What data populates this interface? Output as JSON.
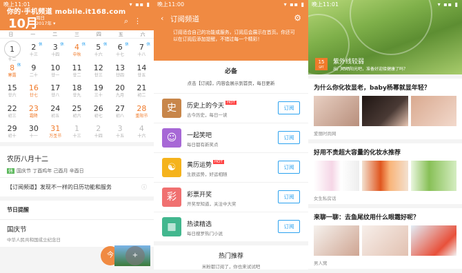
{
  "watermark": "你的·手机频道 mobile.it168.com",
  "status": {
    "time": "晚上11:01",
    "time2": "晚上11:00",
    "time3": "晚上11:01",
    "icons": "▾ ▪▪ ▮"
  },
  "calendar": {
    "month": "10月",
    "month_sub1": "周日",
    "month_sub2": "2017年 ▾",
    "weekdays": [
      "日",
      "一",
      "二",
      "三",
      "四",
      "五",
      "六"
    ],
    "days": [
      {
        "n": "1",
        "l": "十二",
        "t": "",
        "cls": "today"
      },
      {
        "n": "2",
        "l": "十三",
        "t": "休",
        "cls": ""
      },
      {
        "n": "3",
        "l": "十四",
        "t": "休",
        "cls": ""
      },
      {
        "n": "4",
        "l": "中秋",
        "t": "休",
        "cls": "red"
      },
      {
        "n": "5",
        "l": "十六",
        "t": "休",
        "cls": ""
      },
      {
        "n": "6",
        "l": "十七",
        "t": "休",
        "cls": ""
      },
      {
        "n": "7",
        "l": "十八",
        "t": "休",
        "cls": ""
      },
      {
        "n": "8",
        "l": "寒露",
        "t": "休",
        "cls": "red"
      },
      {
        "n": "9",
        "l": "二十",
        "t": "",
        "cls": ""
      },
      {
        "n": "10",
        "l": "廿一",
        "t": "",
        "cls": ""
      },
      {
        "n": "11",
        "l": "廿二",
        "t": "",
        "cls": ""
      },
      {
        "n": "12",
        "l": "廿三",
        "t": "",
        "cls": ""
      },
      {
        "n": "13",
        "l": "廿四",
        "t": "",
        "cls": ""
      },
      {
        "n": "14",
        "l": "廿五",
        "t": "",
        "cls": ""
      },
      {
        "n": "15",
        "l": "廿六",
        "t": "",
        "cls": ""
      },
      {
        "n": "16",
        "l": "廿七",
        "t": "",
        "cls": "red"
      },
      {
        "n": "17",
        "l": "廿八",
        "t": "",
        "cls": ""
      },
      {
        "n": "18",
        "l": "廿九",
        "t": "",
        "cls": ""
      },
      {
        "n": "19",
        "l": "三十",
        "t": "",
        "cls": ""
      },
      {
        "n": "20",
        "l": "九月",
        "t": "",
        "cls": ""
      },
      {
        "n": "21",
        "l": "初二",
        "t": "",
        "cls": ""
      },
      {
        "n": "22",
        "l": "初三",
        "t": "",
        "cls": ""
      },
      {
        "n": "23",
        "l": "霜降",
        "t": "",
        "cls": "red"
      },
      {
        "n": "24",
        "l": "初五",
        "t": "",
        "cls": ""
      },
      {
        "n": "25",
        "l": "初六",
        "t": "",
        "cls": ""
      },
      {
        "n": "26",
        "l": "初七",
        "t": "",
        "cls": ""
      },
      {
        "n": "27",
        "l": "初八",
        "t": "",
        "cls": ""
      },
      {
        "n": "28",
        "l": "重阳节",
        "t": "",
        "cls": "red"
      },
      {
        "n": "29",
        "l": "初十",
        "t": "",
        "cls": ""
      },
      {
        "n": "30",
        "l": "十一",
        "t": "",
        "cls": ""
      },
      {
        "n": "31",
        "l": "万圣节",
        "t": "",
        "cls": "red"
      },
      {
        "n": "1",
        "l": "十三",
        "t": "",
        "cls": "grey"
      },
      {
        "n": "2",
        "l": "十四",
        "t": "",
        "cls": "grey"
      },
      {
        "n": "3",
        "l": "十五",
        "t": "",
        "cls": "grey"
      },
      {
        "n": "4",
        "l": "十六",
        "t": "",
        "cls": "grey"
      }
    ],
    "lunar": "农历八月十二",
    "rest_tag": "休",
    "detail": "国庆节  丁酉鸡年 己酉月 辛酉日",
    "promo": "【订阅频道】发现不一样的日历功能和服务",
    "reminder_title": "节日提醒",
    "holiday": "国庆节",
    "holiday_desc": "中华人民共和国成立纪念日",
    "fab1": "今",
    "fab2": "+"
  },
  "sub": {
    "title": "订阅频道",
    "desc": "订阅适合自己的功能或服务，订阅后会展示在首页。你还可以在订阅后添加提醒，不错过每一个精彩！",
    "ann_title": "必备",
    "ann_sub": "点击【订阅】，内容会展示到首页，每日更新",
    "channels": [
      {
        "icon": "史",
        "color": "#c8864a",
        "name": "历史上的今天",
        "hot": "HOT",
        "desc": "古今历史，每日一读",
        "btn": "订阅"
      },
      {
        "icon": "☺",
        "color": "#a768d6",
        "name": "一起笑吧",
        "hot": "",
        "desc": "每日都有新笑点",
        "btn": "订阅"
      },
      {
        "icon": "☯",
        "color": "#f5b31c",
        "name": "黄历运势",
        "hot": "HOT",
        "desc": "生辰运势，好运相随",
        "btn": "订阅"
      },
      {
        "icon": "彩",
        "color": "#f07070",
        "name": "彩票开奖",
        "hot": "",
        "desc": "开奖早知道，关注中大奖",
        "btn": "订阅"
      },
      {
        "icon": "▦",
        "color": "#42b78e",
        "name": "热读精选",
        "hot": "",
        "desc": "每日搜罗热门小说",
        "btn": "订阅"
      }
    ],
    "rec_title": "热门推荐",
    "rec_sub": "米粉都订阅了，你也来试试吧"
  },
  "feed": {
    "date_day": "15",
    "date_label": "SPT",
    "headline": "紫外线较弱",
    "headline_sub": "出门晒晒阳光吧，准备好迎接健康了吗？",
    "articles": [
      {
        "title": "为什么你化妆显老，baby杨幂就显年轻？",
        "source": "爱丽时尚网"
      },
      {
        "title": "好用不贵超大容量的化妆水推荐",
        "source": "女生私房话"
      },
      {
        "title": "来聊一聊：去鱼尾纹用什么眼霜好呢？",
        "source": "男人窝"
      }
    ]
  }
}
